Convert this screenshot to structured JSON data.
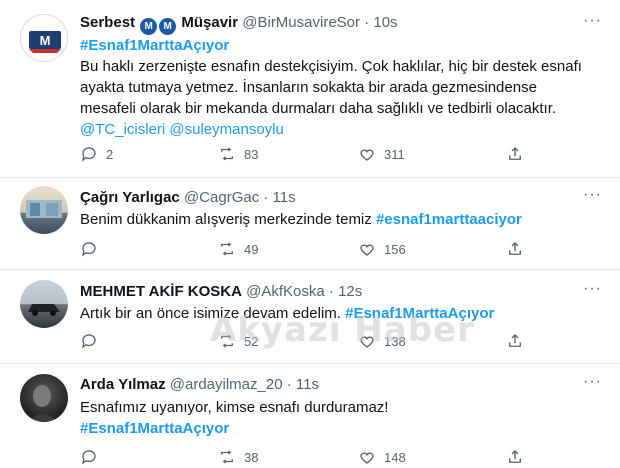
{
  "tweets": [
    {
      "name": "Serbest",
      "name_badges": [
        "M",
        "M"
      ],
      "name_suffix": "Müşavir",
      "handle": "@BirMusavireSor",
      "dot": "·",
      "time": "10s",
      "hashtag_top": "#Esnaf1MarttaAçıyor",
      "text": "Bu haklı zerzenişte esnafın destekçisiyim. Çok haklılar, hiç bir destek esnafı ayakta tutmaya yetmez. İnsanların sokakta bir arada gezmesindense mesafeli olarak bir mekanda durmaları daha sağlıklı ve tedbirli olacaktır.",
      "mentions": "@TC_icisleri @suleymansoylu",
      "replies": "2",
      "retweets": "83",
      "likes": "311"
    },
    {
      "name": "Çağrı Yarlıgac",
      "handle": "@CagrGac",
      "dot": "·",
      "time": "11s",
      "text": "Benim dükkanim alışveriş merkezinde temiz ",
      "hashtag": "#esnaf1marttaaciyor",
      "replies": "",
      "retweets": "49",
      "likes": "156"
    },
    {
      "name": "MEHMET AKİF KOSKA",
      "handle": "@AkfKoska",
      "dot": "·",
      "time": "12s",
      "text": "Artık bir an önce isimize devam edelim. ",
      "hashtag": "#Esnaf1MarttaAçıyor",
      "replies": "",
      "retweets": "52",
      "likes": "138"
    },
    {
      "name": "Arda Yılmaz",
      "handle": "@ardayilmaz_20",
      "dot": "·",
      "time": "11s",
      "text": "Esnafımız uyanıyor, kimse esnafı durduramaz!",
      "hashtag": "#Esnaf1MarttaAçıyor",
      "replies": "",
      "retweets": "38",
      "likes": "148"
    }
  ],
  "more_label": "···",
  "watermark": "Akyazı Haber",
  "icons": {
    "reply": "reply-icon",
    "retweet": "retweet-icon",
    "like": "heart-icon",
    "share": "share-icon"
  },
  "colors": {
    "link": "#1d9bf0",
    "muted": "#536471",
    "badge": "#1d5aa6"
  }
}
